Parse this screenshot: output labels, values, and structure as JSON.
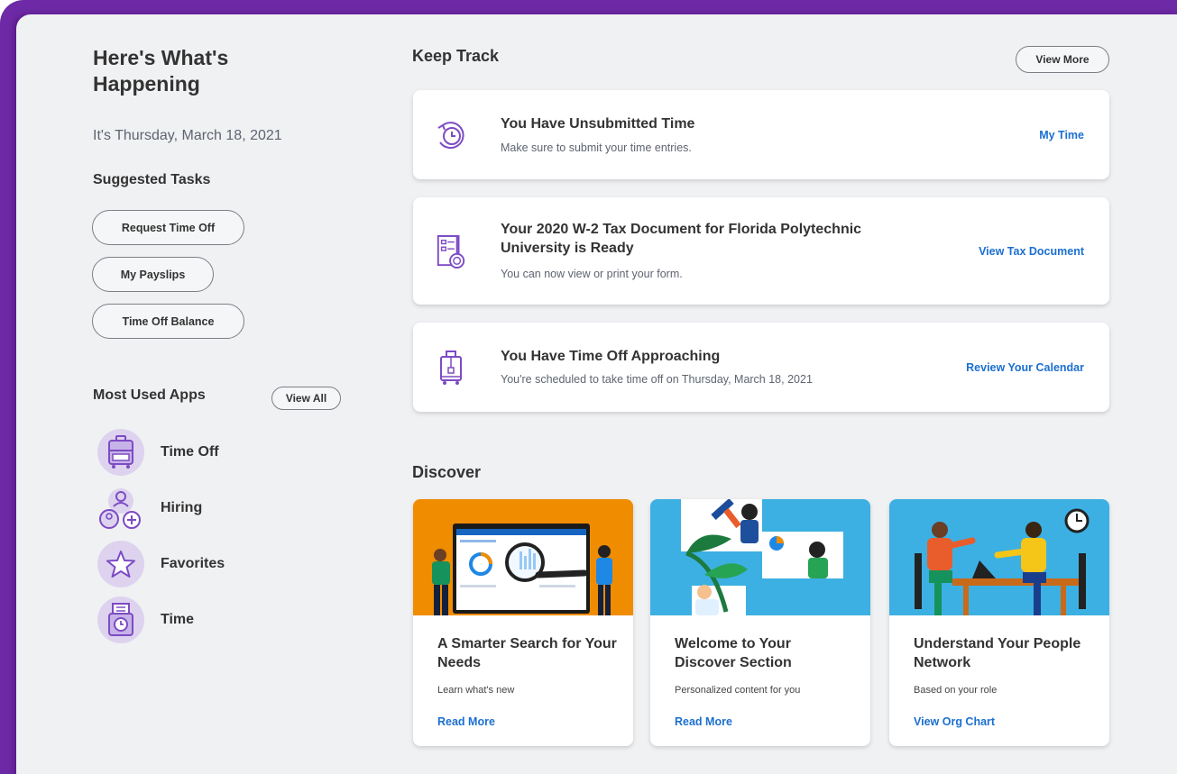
{
  "sidebar": {
    "title": "Here's What's Happening",
    "date": "It's Thursday, March 18, 2021",
    "suggested_tasks_heading": "Suggested Tasks",
    "tasks": [
      "Request Time Off",
      "My Payslips",
      "Time Off Balance"
    ],
    "most_used_heading": "Most Used Apps",
    "view_all_label": "View All",
    "apps": [
      {
        "label": "Time Off",
        "icon": "suitcase-icon"
      },
      {
        "label": "Hiring",
        "icon": "hiring-people-icon"
      },
      {
        "label": "Favorites",
        "icon": "star-icon"
      },
      {
        "label": "Time",
        "icon": "time-clock-icon"
      }
    ]
  },
  "keep_track": {
    "heading": "Keep Track",
    "view_more_label": "View More",
    "items": [
      {
        "title": "You Have Unsubmitted Time",
        "description": "Make sure to submit your time entries.",
        "link": "My Time",
        "icon": "clock-refresh-icon"
      },
      {
        "title": "Your 2020 W-2 Tax Document for Florida Polytechnic University is Ready",
        "description": "You can now view or print your form.",
        "link": "View Tax Document",
        "icon": "tax-document-icon"
      },
      {
        "title": "You Have Time Off Approaching",
        "description": "You're scheduled to take time off on Thursday, March 18, 2021",
        "link": "Review Your Calendar",
        "icon": "suitcase-icon"
      }
    ]
  },
  "discover": {
    "heading": "Discover",
    "cards": [
      {
        "title": "A Smarter Search for Your Needs",
        "description": "Learn what's new",
        "link": "Read More",
        "image": "search-illustration"
      },
      {
        "title": "Welcome to Your Discover Section",
        "description": "Personalized content for you",
        "link": "Read More",
        "image": "discover-illustration"
      },
      {
        "title": "Understand Your People Network",
        "description": "Based on your role",
        "link": "View Org Chart",
        "image": "people-network-illustration"
      }
    ]
  },
  "colors": {
    "accent_purple": "#6e2aa6",
    "icon_purple": "#7d4bc4",
    "link_blue": "#1b6fd0",
    "background": "#f0f1f3",
    "discover_orange": "#f08c00",
    "discover_blue": "#3cb0e2"
  }
}
